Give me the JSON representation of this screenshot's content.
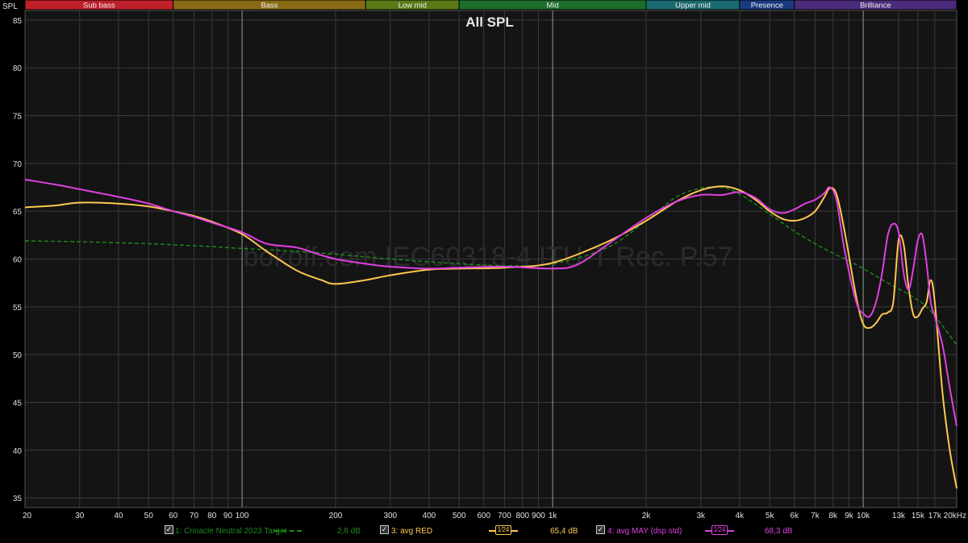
{
  "app": {
    "ylabel": "SPL",
    "watermark": "bokoff.com IEC60318-4 ITU-T Rec. P.57"
  },
  "bands": [
    {
      "label": "Sub bass",
      "from": 20,
      "to": 60,
      "color": "#c0202a"
    },
    {
      "label": "Bass",
      "from": 60,
      "to": 250,
      "color": "#8a6a15"
    },
    {
      "label": "Low mid",
      "from": 250,
      "to": 500,
      "color": "#5a7a18"
    },
    {
      "label": "Mid",
      "from": 500,
      "to": 2000,
      "color": "#1c6e2c"
    },
    {
      "label": "Upper mid",
      "from": 2000,
      "to": 4000,
      "color": "#1a6a70"
    },
    {
      "label": "Presence",
      "from": 4000,
      "to": 6000,
      "color": "#1a3a80"
    },
    {
      "label": "Brilliance",
      "from": 6000,
      "to": 20000,
      "color": "#4a2c7a"
    }
  ],
  "legend": [
    {
      "checked": "✓",
      "label": "1: Crinacle Neutral 2023 Target",
      "value": "2,8 dB",
      "color": "#1e8a1e",
      "smoothing": ""
    },
    {
      "checked": "✓",
      "label": "3: avg RED",
      "value": "65,4 dB",
      "color": "#ffc850",
      "smoothing": "1⁄24"
    },
    {
      "checked": "✓",
      "label": "4: avg MAY (dsp std)",
      "value": "68,3 dB",
      "color": "#e040e0",
      "smoothing": "1⁄24"
    }
  ],
  "chart_data": {
    "type": "line",
    "title": "All SPL",
    "xlabel": "",
    "ylabel": "SPL",
    "x_scale": "log",
    "xlim": [
      20,
      20000
    ],
    "ylim": [
      34,
      86
    ],
    "grid": true,
    "x_ticks": [
      "20",
      "30",
      "40",
      "50",
      "60",
      "70",
      "80",
      "90",
      "100",
      "200",
      "300",
      "400",
      "500",
      "600",
      "700",
      "800",
      "900",
      "1k",
      "2k",
      "3k",
      "4k",
      "5k",
      "6k",
      "7k",
      "8k",
      "9k",
      "10k",
      "13k",
      "15k",
      "17k",
      "20kHz"
    ],
    "x_tick_values": [
      20,
      30,
      40,
      50,
      60,
      70,
      80,
      90,
      100,
      200,
      300,
      400,
      500,
      600,
      700,
      800,
      900,
      1000,
      2000,
      3000,
      4000,
      5000,
      6000,
      7000,
      8000,
      9000,
      10000,
      13000,
      15000,
      17000,
      20000
    ],
    "y_ticks": [
      35,
      40,
      45,
      50,
      55,
      60,
      65,
      70,
      75,
      80,
      85
    ],
    "series": [
      {
        "name": "1: Crinacle Neutral 2023 Target",
        "color": "#1e8a1e",
        "dashed": true,
        "x": [
          20,
          30,
          50,
          80,
          100,
          150,
          200,
          300,
          500,
          700,
          1000,
          1500,
          2000,
          2500,
          3000,
          3500,
          4000,
          5000,
          6000,
          7000,
          8000,
          9000,
          10000,
          12000,
          14000,
          16000,
          18000,
          20000
        ],
        "y": [
          61.9,
          61.8,
          61.6,
          61.3,
          61.1,
          60.8,
          60.5,
          60.0,
          59.5,
          59.3,
          59.5,
          61.2,
          64.0,
          66.5,
          67.4,
          67.5,
          66.8,
          64.7,
          62.9,
          61.6,
          60.6,
          59.8,
          59.0,
          57.5,
          56.3,
          55.0,
          53.0,
          51.0
        ]
      },
      {
        "name": "3: avg RED",
        "color": "#ffc850",
        "dashed": false,
        "x": [
          20,
          25,
          30,
          40,
          50,
          60,
          70,
          80,
          100,
          120,
          150,
          180,
          200,
          250,
          300,
          400,
          500,
          700,
          1000,
          1500,
          2000,
          2500,
          3000,
          3500,
          4000,
          4500,
          5000,
          5500,
          6000,
          6500,
          7000,
          7500,
          7800,
          8200,
          8700,
          9500,
          10000,
          10500,
          11000,
          11500,
          12000,
          12500,
          13000,
          13500,
          14000,
          14500,
          15000,
          15500,
          16000,
          16500,
          17000,
          18000,
          19000,
          20000
        ],
        "y": [
          65.4,
          65.6,
          65.9,
          65.8,
          65.5,
          65.0,
          64.5,
          63.9,
          62.6,
          60.8,
          58.8,
          57.8,
          57.4,
          57.8,
          58.3,
          58.9,
          59.0,
          59.1,
          59.6,
          61.8,
          64.0,
          66.0,
          67.2,
          67.6,
          67.2,
          66.2,
          65.0,
          64.2,
          64.0,
          64.3,
          65.0,
          66.5,
          67.4,
          66.8,
          63.0,
          56.0,
          53.2,
          52.8,
          53.3,
          54.2,
          54.4,
          55.5,
          62.0,
          61.5,
          57.0,
          54.2,
          54.0,
          54.8,
          55.5,
          57.8,
          55.5,
          46.0,
          40.0,
          36.0
        ]
      },
      {
        "name": "4: avg MAY (dsp std)",
        "color": "#e040e0",
        "dashed": false,
        "x": [
          20,
          25,
          30,
          40,
          50,
          60,
          70,
          80,
          100,
          120,
          150,
          180,
          200,
          250,
          300,
          400,
          500,
          700,
          1000,
          1200,
          1500,
          2000,
          2500,
          3000,
          3500,
          4000,
          4500,
          5000,
          5500,
          6000,
          6500,
          7000,
          7500,
          7800,
          8200,
          8700,
          9500,
          10000,
          10500,
          11000,
          11500,
          12000,
          12500,
          13000,
          13500,
          14000,
          14500,
          15000,
          15500,
          16000,
          16500,
          17000,
          18000,
          19000,
          20000
        ],
        "y": [
          68.3,
          67.8,
          67.3,
          66.5,
          65.8,
          65.0,
          64.4,
          63.8,
          62.8,
          61.6,
          61.2,
          60.4,
          60.0,
          59.5,
          59.2,
          59.0,
          59.1,
          59.2,
          59.0,
          59.4,
          61.5,
          64.3,
          66.0,
          66.7,
          66.7,
          67.0,
          66.4,
          65.2,
          64.8,
          65.2,
          65.8,
          66.2,
          66.9,
          67.5,
          66.2,
          61.0,
          55.5,
          54.3,
          54.0,
          55.5,
          58.5,
          62.5,
          63.7,
          62.8,
          58.5,
          56.8,
          59.0,
          62.0,
          62.5,
          59.5,
          55.5,
          54.0,
          51.0,
          46.5,
          42.5
        ]
      }
    ]
  }
}
